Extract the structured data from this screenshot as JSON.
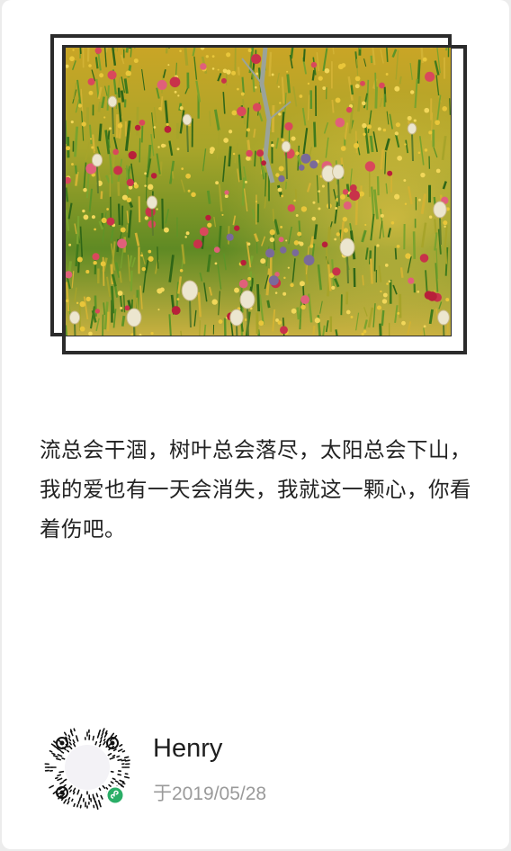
{
  "post": {
    "quote": "流总会干涸，树叶总会落尽，太阳总会下山，我的爱也有一天会消失，我就这一颗心，你看着伤吧。",
    "author": "Henry",
    "date": "于2019/05/28"
  },
  "image": {
    "subject": "wildflower meadow with pasqueflower seed heads and red paintbrush flowers",
    "frame_color": "#2b2b2b"
  },
  "qr_code": {
    "badge_icon": "mini-program-icon",
    "badge_color": "#2aae67"
  }
}
